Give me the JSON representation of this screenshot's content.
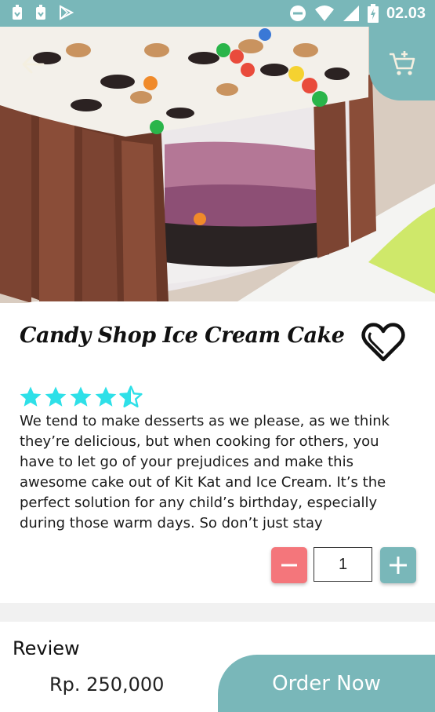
{
  "status_bar": {
    "time": "02.03"
  },
  "product": {
    "title": "Candy Shop Ice Cream Cake",
    "rating": 4.5,
    "rating_max": 5,
    "description": "We tend to make desserts as we please, as we think they’re delicious, but when cooking for others, you have to let go of your prejudices and make this awesome cake out of Kit Kat and Ice Cream. It’s the perfect solution for any child’s birthday, especially during those warm days. So don’t just stay"
  },
  "quantity": {
    "value": "1"
  },
  "review": {
    "heading": "Review"
  },
  "footer": {
    "price": "Rp. 250,000",
    "order_label": "Order Now"
  },
  "colors": {
    "accent": "#79b7b9",
    "minus": "#f4767b",
    "star": "#2ee0e8"
  },
  "icons": [
    "back-arrow-icon",
    "add-to-cart-icon",
    "heart-icon",
    "minus-icon",
    "plus-icon"
  ]
}
